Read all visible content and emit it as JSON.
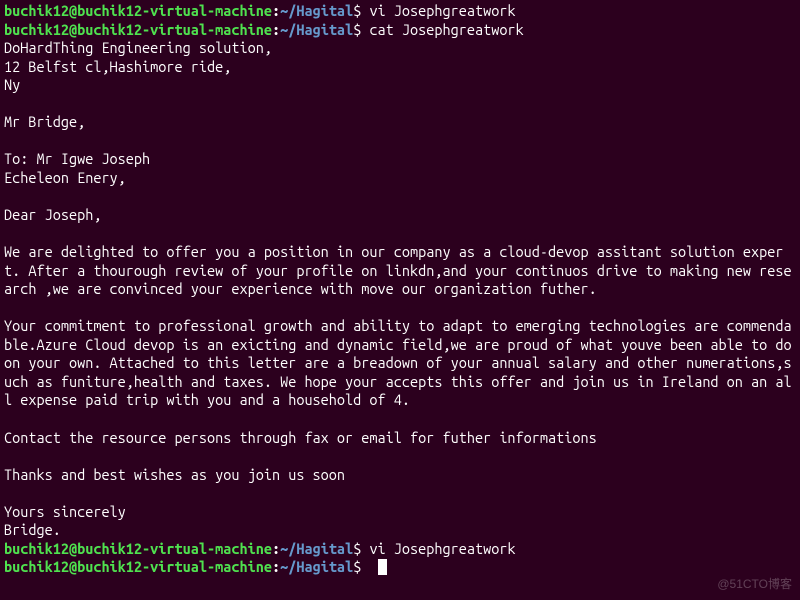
{
  "prompt": {
    "user_host": "buchik12@buchik12-virtual-machine",
    "sep": ":",
    "path": "~/Hagital",
    "symbol": "$ "
  },
  "commands": {
    "c1": "vi Josephgreatwork",
    "c2": "cat Josephgreatwork",
    "c3": "vi Josephgreatwork",
    "c4": ""
  },
  "output": {
    "l01": "DoHardThing Engineering solution,",
    "l02": "12 Belfst cl,Hashimore ride,",
    "l03": "Ny",
    "l04": "",
    "l05": "Mr Bridge,",
    "l06": "",
    "l07": "To: Mr Igwe Joseph",
    "l08": "Echeleon Enery,",
    "l09": "",
    "l10": "Dear Joseph,",
    "l11": "",
    "l12": "We are delighted to offer you a position in our company as a cloud-devop assitant solution expert. After a thourough review of your profile on linkdn,and your continuos drive to making new research ,we are convinced your experience with move our organization futher.",
    "l13": "",
    "l14": "Your commitment to professional growth and ability to adapt to emerging technologies are commendable.Azure Cloud devop is an exicting and dynamic field,we are proud of what youve been able to do on your own. Attached to this letter are a breadown of your annual salary and other numerations,such as funiture,health and taxes. We hope your accepts this offer and join us in Ireland on an all expense paid trip with you and a household of 4.",
    "l15": "",
    "l16": "Contact the resource persons through fax or email for futher informations",
    "l17": "",
    "l18": "Thanks and best wishes as you join us soon",
    "l19": "",
    "l20": "Yours sincerely",
    "l21": "Bridge."
  },
  "watermark": "@51CTO博客"
}
